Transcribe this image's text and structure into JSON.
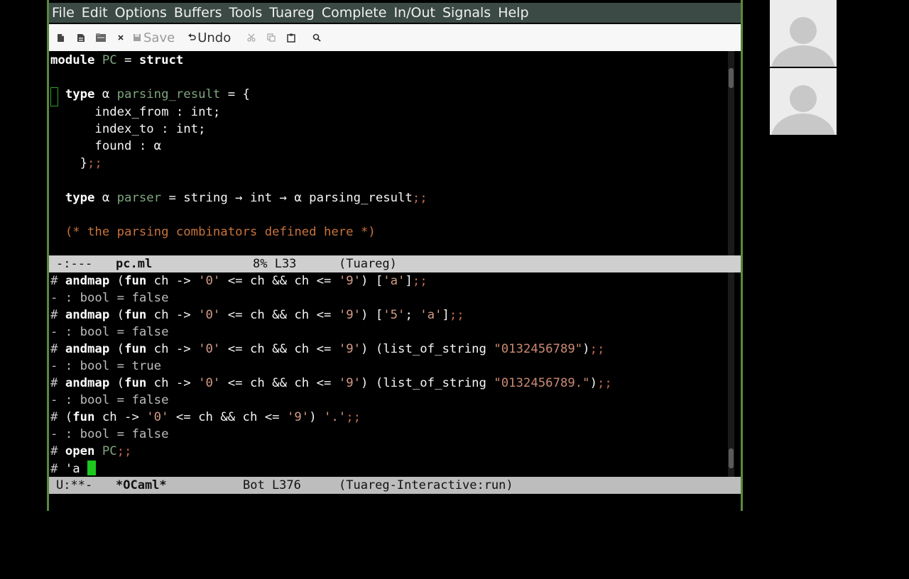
{
  "menubar": [
    "File",
    "Edit",
    "Options",
    "Buffers",
    "Tools",
    "Tuareg",
    "Complete",
    "In/Out",
    "Signals",
    "Help"
  ],
  "toolbar": {
    "new_icon": "new-file-icon",
    "open_icon": "open-file-icon",
    "dired_icon": "dired-icon",
    "close_icon": "close-icon",
    "save_label": "Save",
    "undo_label": "Undo",
    "cut_icon": "scissors-icon",
    "copy_icon": "copy-icon",
    "paste_icon": "paste-icon",
    "search_icon": "search-icon"
  },
  "editor": {
    "lines": [
      {
        "t": "module PC = struct"
      },
      {
        "t": ""
      },
      {
        "t": "  type α parsing_result = {"
      },
      {
        "t": "      index_from : int;"
      },
      {
        "t": "      index_to : int;"
      },
      {
        "t": "      found : α"
      },
      {
        "t": "    };;"
      },
      {
        "t": ""
      },
      {
        "t": "  type α parser = string → int → α parsing_result;;"
      },
      {
        "t": ""
      },
      {
        "t": "  (* the parsing combinators defined here *)"
      }
    ]
  },
  "modeline_top": {
    "status": "-:---",
    "buffer": "pc.ml",
    "position": "8% L33",
    "mode": "(Tuareg)"
  },
  "repl": {
    "lines": [
      "# andmap (fun ch -> '0' <= ch && ch <= '9') ['a'];;",
      "- : bool = false",
      "# andmap (fun ch -> '0' <= ch && ch <= '9') ['5'; 'a'];;",
      "- : bool = false",
      "# andmap (fun ch -> '0' <= ch && ch <= '9') (list_of_string \"0132456789\");;",
      "- : bool = true",
      "# andmap (fun ch -> '0' <= ch && ch <= '9') (list_of_string \"0132456789.\");;",
      "- : bool = false",
      "# (fun ch -> '0' <= ch && ch <= '9') '.';;",
      "- : bool = false",
      "# open PC;;",
      "# 'a "
    ]
  },
  "modeline_bottom": {
    "status": "U:**-",
    "buffer": "*OCaml*",
    "position": "Bot L376",
    "mode": "(Tuareg-Interactive:run)"
  },
  "colors": {
    "cursor": "#1ec81e",
    "frame_border": "#5a8a3a",
    "menubar_bg": "#3b4a45"
  },
  "video": {
    "avatar_icon": "user-avatar-icon"
  }
}
